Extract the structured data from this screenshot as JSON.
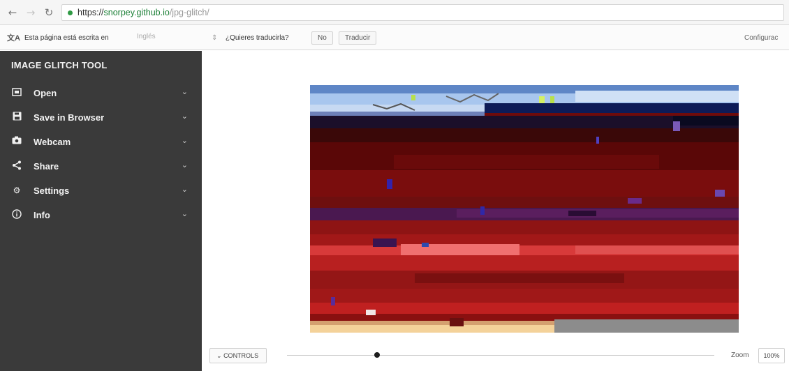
{
  "browser": {
    "url_scheme": "https://",
    "url_host": "snorpey.github.io",
    "url_path": "/jpg-glitch/",
    "icons": [
      "back-arrow-icon",
      "forward-arrow-icon",
      "reload-icon",
      "secure-icon"
    ]
  },
  "translate_bar": {
    "icon": "translate-icon",
    "message": "Esta página está escrita en",
    "language": "Inglés",
    "question": "¿Quieres traducirla?",
    "no_label": "No",
    "translate_label": "Traducir",
    "settings_label": "Configurac"
  },
  "sidebar": {
    "title": "IMAGE GLITCH TOOL",
    "items": [
      {
        "label": "Open",
        "icon": "open-image-icon"
      },
      {
        "label": "Save in Browser",
        "icon": "save-icon"
      },
      {
        "label": "Webcam",
        "icon": "camera-icon"
      },
      {
        "label": "Share",
        "icon": "share-icon"
      },
      {
        "label": "Settings",
        "icon": "gear-icon"
      },
      {
        "label": "Info",
        "icon": "info-icon"
      }
    ]
  },
  "controls": {
    "toggle_label": "CONTROLS",
    "slider_value": 0.21,
    "zoom_label": "Zoom",
    "zoom_value": "100%"
  },
  "colors": {
    "sidebar_bg": "#3a3a3a",
    "glitch_sky": "#9fc0e8",
    "glitch_dark_red": "#6e0b0b",
    "glitch_red": "#c01a1a"
  }
}
